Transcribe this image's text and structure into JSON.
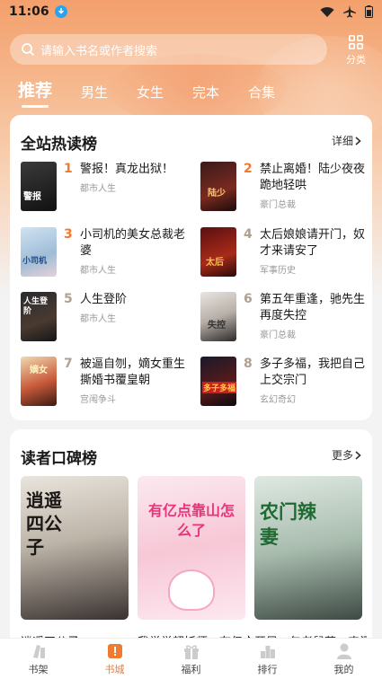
{
  "status": {
    "time": "11:06"
  },
  "search": {
    "placeholder": "请输入书名或作者搜索"
  },
  "category": {
    "label": "分类"
  },
  "tabs": [
    {
      "label": "推荐",
      "active": true
    },
    {
      "label": "男生"
    },
    {
      "label": "女生"
    },
    {
      "label": "完本"
    },
    {
      "label": "合集"
    }
  ],
  "hot": {
    "title": "全站热读榜",
    "link": "详细",
    "items": [
      {
        "rank": "1",
        "title": "警报！真龙出狱！",
        "tag": "都市人生",
        "cover_text": "警报"
      },
      {
        "rank": "2",
        "title": "禁止离婚！陆少夜夜跪地轻哄",
        "tag": "豪门总裁",
        "cover_text": "陆少"
      },
      {
        "rank": "3",
        "title": "小司机的美女总裁老婆",
        "tag": "都市人生",
        "cover_text": "小司机"
      },
      {
        "rank": "4",
        "title": "太后娘娘请开门，奴才来请安了",
        "tag": "军事历史",
        "cover_text": "太后"
      },
      {
        "rank": "5",
        "title": "人生登阶",
        "tag": "都市人生",
        "cover_text": "人生登阶"
      },
      {
        "rank": "6",
        "title": "第五年重逢，驰先生再度失控",
        "tag": "豪门总裁",
        "cover_text": "失控"
      },
      {
        "rank": "7",
        "title": "被逼自刎，嫡女重生撕婚书覆皇朝",
        "tag": "宫闱争斗",
        "cover_text": "嫡女"
      },
      {
        "rank": "8",
        "title": "多子多福，我把自己上交宗门",
        "tag": "玄幻奇幻",
        "cover_text": "多子多福"
      }
    ]
  },
  "reader": {
    "title": "读者口碑榜",
    "link": "更多",
    "items": [
      {
        "caption": "逍遥四公子",
        "cover_text": "逍遥四公子"
      },
      {
        "caption": "我觉觉超妖师，有亿点靠山怎么了",
        "cover_text": "有亿点靠山怎么了"
      },
      {
        "caption": "开局一包老鼠药，农门辣妻",
        "cover_text": "农门辣妻"
      }
    ]
  },
  "nav": [
    {
      "label": "书架",
      "icon": "bookshelf-icon"
    },
    {
      "label": "书城",
      "icon": "bookstore-icon",
      "active": true
    },
    {
      "label": "福利",
      "icon": "gift-icon"
    },
    {
      "label": "排行",
      "icon": "ranking-icon"
    },
    {
      "label": "我的",
      "icon": "profile-icon"
    }
  ],
  "colors": {
    "accent": "#f07a2f",
    "rank_top": "#f07a2f",
    "rank_other": "#b0a090"
  }
}
